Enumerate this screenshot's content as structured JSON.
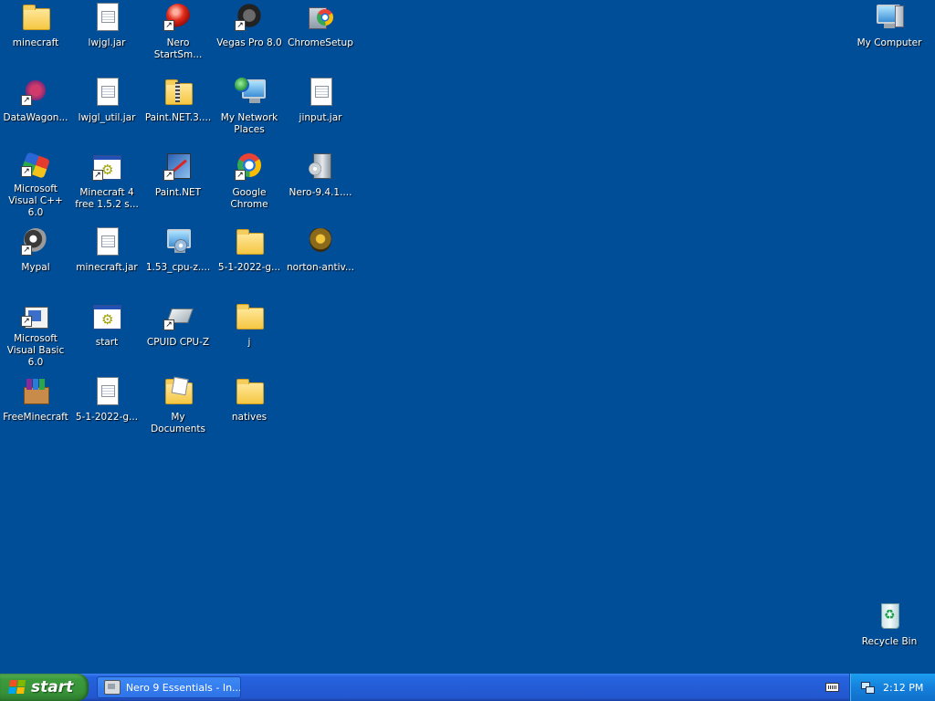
{
  "desktop": {
    "icons": [
      {
        "label": "minecraft",
        "icon": "folder-icon"
      },
      {
        "label": "lwjgl.jar",
        "icon": "jar-file-icon"
      },
      {
        "label": "Nero StartSm...",
        "icon": "nero-startsmart-icon"
      },
      {
        "label": "Vegas Pro 8.0",
        "icon": "vegas-pro-icon"
      },
      {
        "label": "ChromeSetup",
        "icon": "chrome-setup-icon"
      },
      {
        "label": "DataWagon...",
        "icon": "datawagon-icon"
      },
      {
        "label": "lwjgl_util.jar",
        "icon": "jar-file-icon"
      },
      {
        "label": "Paint.NET.3....",
        "icon": "zip-folder-icon"
      },
      {
        "label": "My Network Places",
        "icon": "network-places-icon"
      },
      {
        "label": "jinput.jar",
        "icon": "jar-file-icon"
      },
      {
        "label": "Microsoft Visual C++ 6.0",
        "icon": "visual-cpp-icon"
      },
      {
        "label": "Minecraft 4 free 1.5.2 s...",
        "icon": "batch-file-icon"
      },
      {
        "label": "Paint.NET",
        "icon": "paint-net-icon"
      },
      {
        "label": "Google Chrome",
        "icon": "chrome-icon"
      },
      {
        "label": "Nero-9.4.1....",
        "icon": "nero-installer-icon"
      },
      {
        "label": "Mypal",
        "icon": "mypal-icon"
      },
      {
        "label": "minecraft.jar",
        "icon": "jar-file-icon"
      },
      {
        "label": "1.53_cpu-z....",
        "icon": "cpu-z-installer-icon"
      },
      {
        "label": "5-1-2022-g...",
        "icon": "folder-icon"
      },
      {
        "label": "norton-antiv...",
        "icon": "norton-icon"
      },
      {
        "label": "Microsoft Visual Basic 6.0",
        "icon": "visual-basic-icon"
      },
      {
        "label": "start",
        "icon": "batch-file-icon"
      },
      {
        "label": "CPUID CPU-Z",
        "icon": "cpu-z-icon"
      },
      {
        "label": "j",
        "icon": "folder-icon"
      },
      {
        "label": "FreeMinecraft",
        "icon": "winrar-archive-icon"
      },
      {
        "label": "5-1-2022-g...",
        "icon": "jar-file-icon"
      },
      {
        "label": "My Documents",
        "icon": "my-documents-icon"
      },
      {
        "label": "natives",
        "icon": "folder-icon"
      },
      {
        "label": "My Computer",
        "icon": "my-computer-icon"
      },
      {
        "label": "Recycle Bin",
        "icon": "recycle-bin-icon"
      }
    ]
  },
  "taskbar": {
    "start_label": "start",
    "task_button_label": "Nero 9 Essentials - In...",
    "clock": "2:12 PM"
  },
  "colors": {
    "desktop_background": "#004e98",
    "taskbar": "#245dd7",
    "start_button": "#3c9b3c",
    "tray": "#1580dc"
  }
}
